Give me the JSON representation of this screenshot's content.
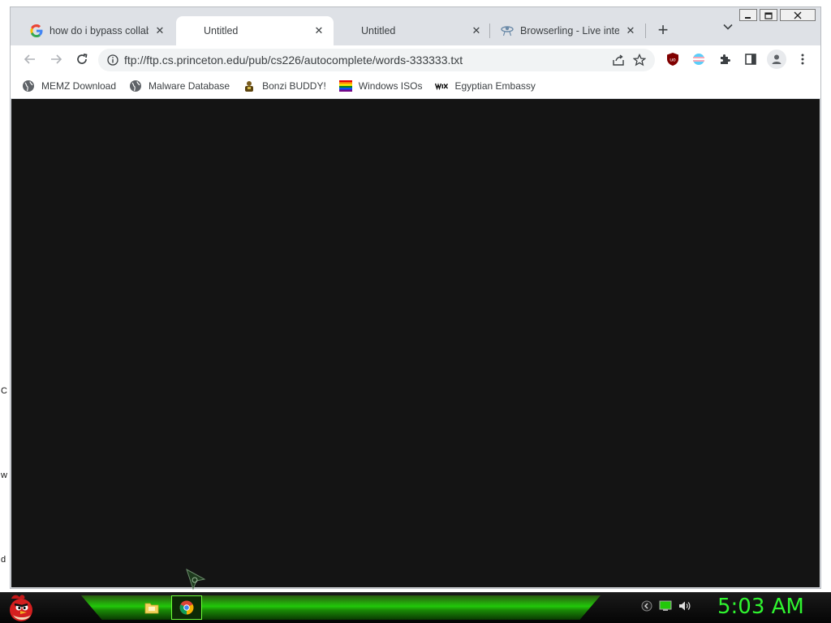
{
  "desktop": {
    "edge_letters": [
      "C",
      "w",
      "d"
    ]
  },
  "tabs": [
    {
      "title": "how do i bypass collabr",
      "favicon": "google-g-icon",
      "active": false
    },
    {
      "title": "Untitled",
      "favicon": "",
      "active": true
    },
    {
      "title": "Untitled",
      "favicon": "",
      "active": false
    },
    {
      "title": "Browserling - Live intera",
      "favicon": "browserling-icon",
      "active": false
    }
  ],
  "toolbar": {
    "url": "ftp://ftp.cs.princeton.edu/pub/cs226/autocomplete/words-333333.txt"
  },
  "bookmarks": [
    {
      "label": "MEMZ Download",
      "icon": "globe-icon"
    },
    {
      "label": "Malware Database",
      "icon": "globe-icon"
    },
    {
      "label": "Bonzi BUDDY!",
      "icon": "bonzi-icon"
    },
    {
      "label": "Windows ISOs",
      "icon": "rainbow-flag-icon"
    },
    {
      "label": "Egyptian Embassy",
      "icon": "wix-icon"
    }
  ],
  "taskbar": {
    "clock": "5:03 AM",
    "accent": "#22c80a"
  },
  "colors": {
    "content_bg": "#141414",
    "tabstrip_bg": "#dee1e6",
    "clock_color": "#2ff52f"
  }
}
